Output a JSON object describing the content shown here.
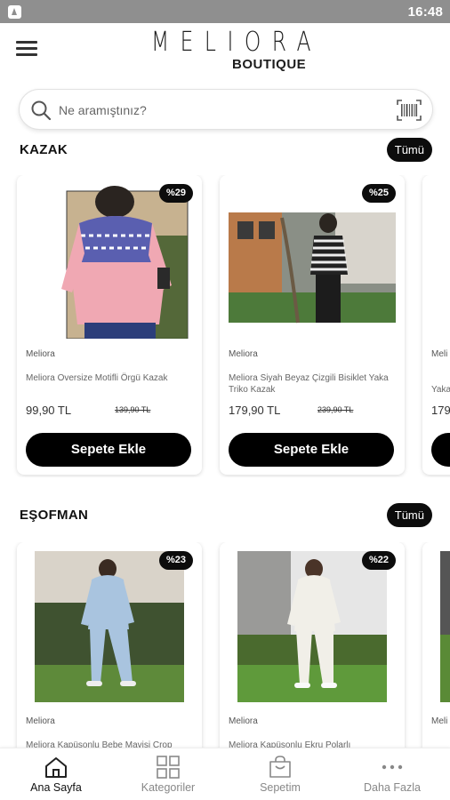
{
  "status_bar": {
    "time": "16:48"
  },
  "header": {
    "logo_text": "MELIORA",
    "logo_sub": "BOUTIQUE"
  },
  "search": {
    "placeholder": "Ne aramıştınız?"
  },
  "sections": [
    {
      "title": "KAZAK",
      "all_label": "Tümü",
      "products": [
        {
          "discount": "%29",
          "brand": "Meliora",
          "name": "Meliora Oversize Motifli Örgü Kazak",
          "price": "99,90 TL",
          "old_price": "139,90 TL",
          "button": "Sepete Ekle"
        },
        {
          "discount": "%25",
          "brand": "Meliora",
          "name": "Meliora Siyah Beyaz Çizgili Bisiklet Yaka Triko Kazak",
          "price": "179,90 TL",
          "old_price": "239,90 TL",
          "button": "Sepete Ekle"
        },
        {
          "brand": "Meli",
          "name": "Yaka",
          "price": "179"
        }
      ]
    },
    {
      "title": "EŞOFMAN",
      "all_label": "Tümü",
      "products": [
        {
          "discount": "%23",
          "brand": "Meliora",
          "name": "Meliora Kapüşonlu Bebe Mavisi Crop"
        },
        {
          "discount": "%22",
          "brand": "Meliora",
          "name": "Meliora Kapüşonlu Ekru Polarlı"
        },
        {
          "brand": "Meli"
        }
      ]
    }
  ],
  "bottom_nav": [
    {
      "label": "Ana Sayfa",
      "icon": "home-icon"
    },
    {
      "label": "Kategoriler",
      "icon": "grid-icon"
    },
    {
      "label": "Sepetim",
      "icon": "cart-icon"
    },
    {
      "label": "Daha Fazla",
      "icon": "more-icon"
    }
  ]
}
